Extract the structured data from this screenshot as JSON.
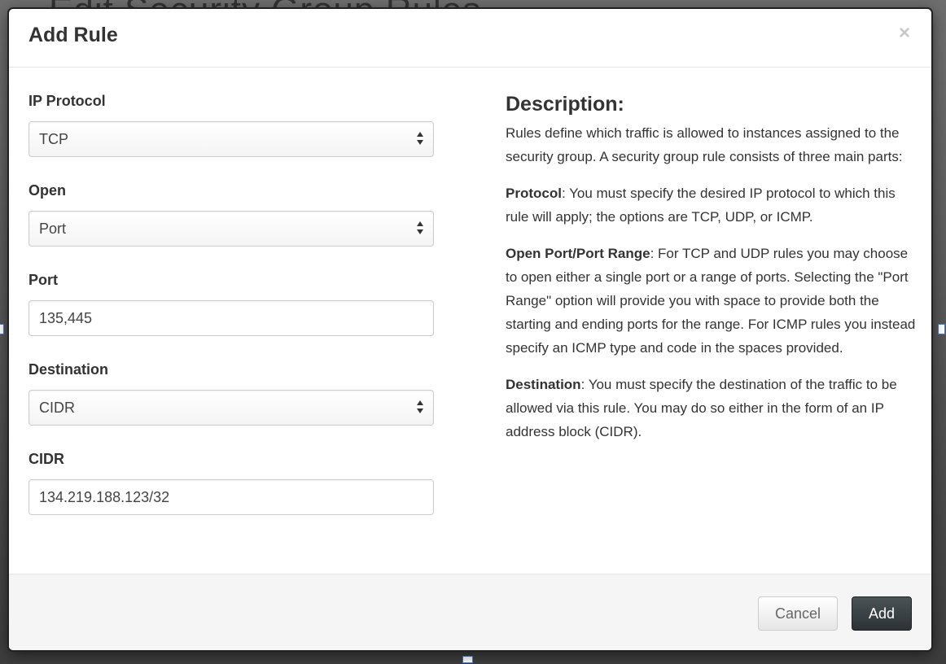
{
  "background": {
    "title": "Edit Security Group Rules"
  },
  "dialog": {
    "title": "Add Rule",
    "close_glyph": "×"
  },
  "form": {
    "ip_protocol": {
      "label": "IP Protocol",
      "value": "TCP"
    },
    "open": {
      "label": "Open",
      "value": "Port"
    },
    "port": {
      "label": "Port",
      "value": "135,445"
    },
    "destination": {
      "label": "Destination",
      "value": "CIDR"
    },
    "cidr": {
      "label": "CIDR",
      "value": "134.219.188.123/32"
    }
  },
  "description": {
    "heading": "Description:",
    "intro": "Rules define which traffic is allowed to instances assigned to the security group. A security group rule consists of three main parts:",
    "protocol_term": "Protocol",
    "protocol_text": ": You must specify the desired IP protocol to which this rule will apply; the options are TCP, UDP, or ICMP.",
    "open_term": "Open Port/Port Range",
    "open_text": ": For TCP and UDP rules you may choose to open either a single port or a range of ports. Selecting the \"Port Range\" option will provide you with space to provide both the starting and ending ports for the range. For ICMP rules you instead specify an ICMP type and code in the spaces provided.",
    "destination_term": "Destination",
    "destination_text": ": You must specify the destination of the traffic to be allowed via this rule. You may do so either in the form of an IP address block (CIDR)."
  },
  "footer": {
    "cancel_label": "Cancel",
    "add_label": "Add"
  }
}
